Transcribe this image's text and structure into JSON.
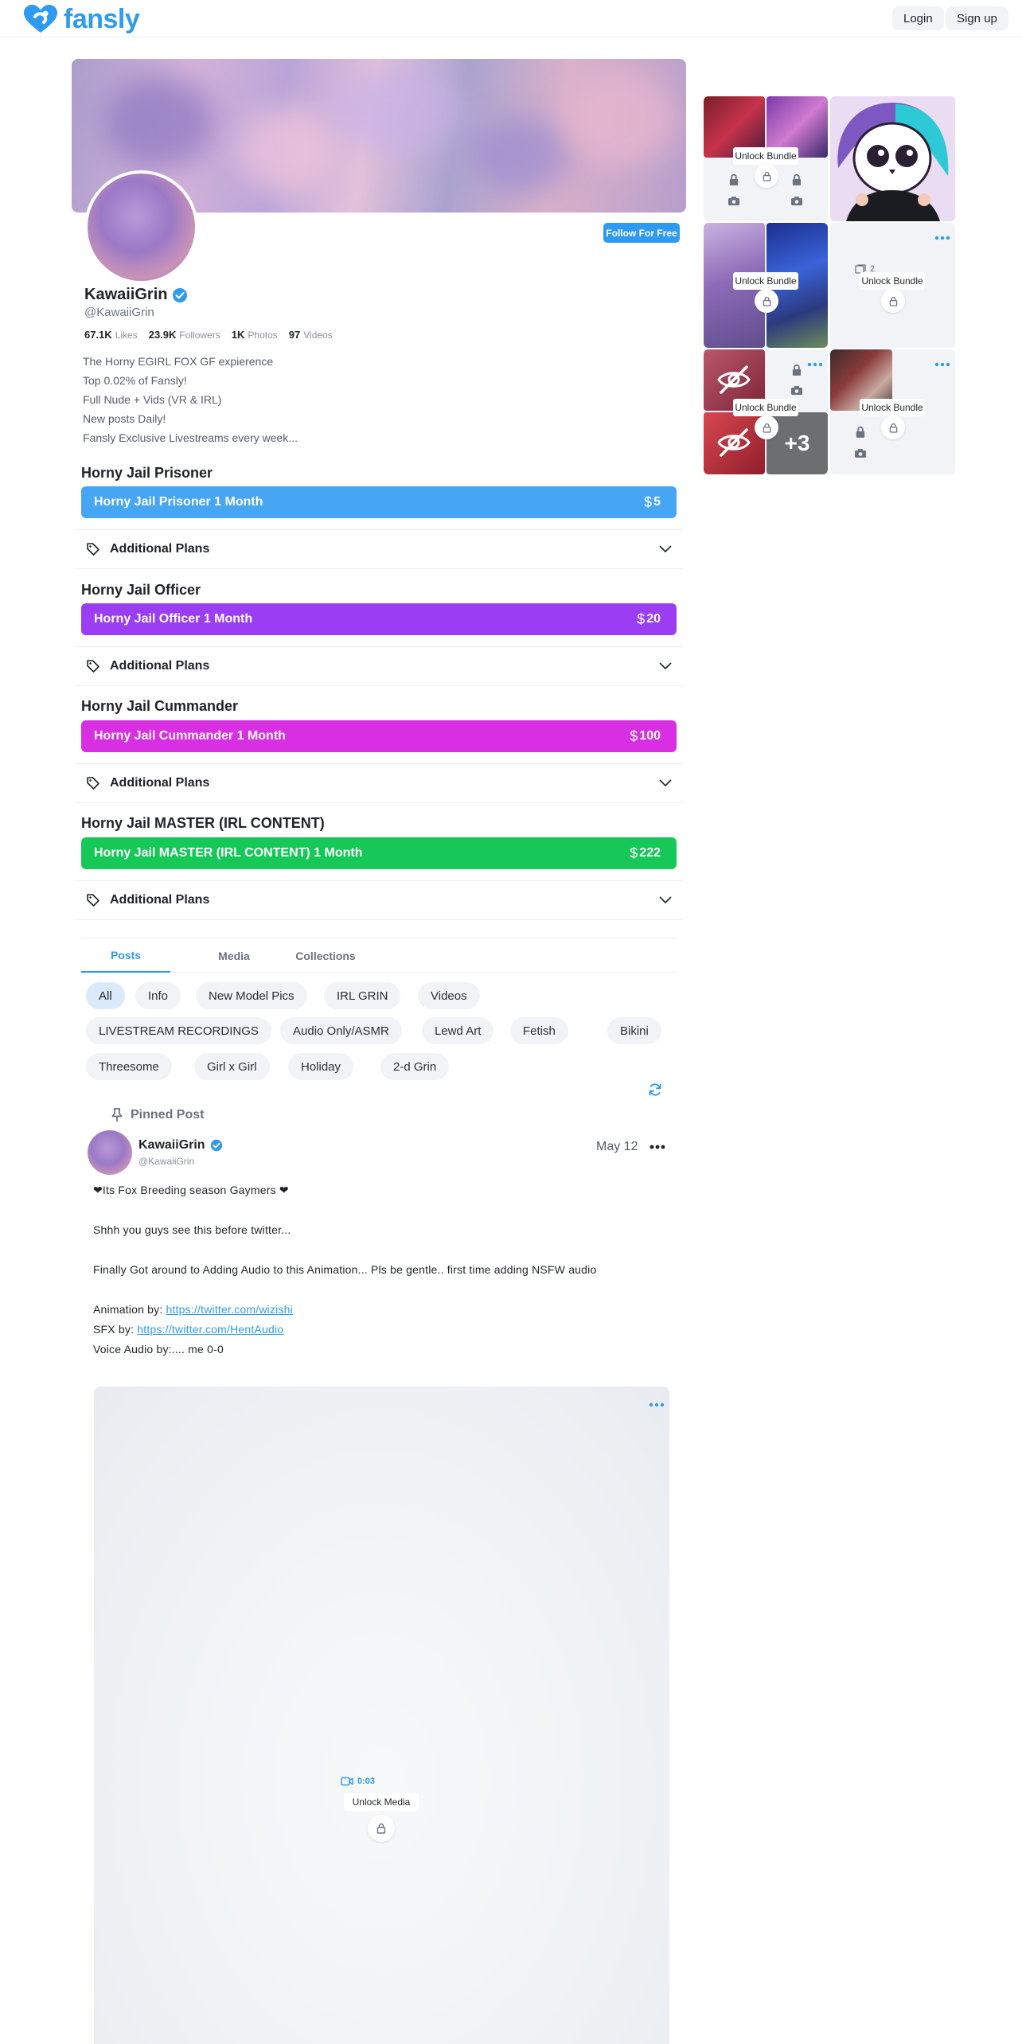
{
  "brand": {
    "name": "fansly",
    "color": "#2e9bf0"
  },
  "topbar": {
    "login_label": "Login",
    "signup_label": "Sign up"
  },
  "profile": {
    "follow_label": "Follow For Free",
    "name": "KawaiiGrin",
    "handle": "@KawaiiGrin",
    "stats": [
      {
        "value": "67.1K",
        "label": "Likes"
      },
      {
        "value": "23.9K",
        "label": "Followers"
      },
      {
        "value": "1K",
        "label": "Photos"
      },
      {
        "value": "97",
        "label": "Videos"
      }
    ],
    "bio": [
      "The Horny EGIRL FOX GF expierence",
      "Top 0.02% of Fansly!",
      "Full Nude + Vids (VR & IRL)",
      "New posts Daily!",
      "Fansly Exclusive Livestreams every week..."
    ]
  },
  "tiers": [
    {
      "title": "Horny Jail Prisoner",
      "bar_label": "Horny Jail Prisoner 1 Month",
      "price": "5",
      "color": "#46a6f3",
      "plans_label": "Additional Plans"
    },
    {
      "title": "Horny Jail Officer",
      "bar_label": "Horny Jail Officer 1 Month",
      "price": "20",
      "color": "#9b3df2",
      "plans_label": "Additional Plans"
    },
    {
      "title": "Horny Jail Cummander",
      "bar_label": "Horny Jail Cummander 1 Month",
      "price": "100",
      "color": "#d92fe3",
      "plans_label": "Additional Plans"
    },
    {
      "title": "Horny Jail MASTER (IRL CONTENT)",
      "bar_label": "Horny Jail MASTER (IRL CONTENT) 1 Month",
      "price": "222",
      "color": "#16c857",
      "plans_label": "Additional Plans"
    }
  ],
  "tabs": [
    "Posts",
    "Media",
    "Collections"
  ],
  "filters": [
    "All",
    "Info",
    "New Model Pics",
    "IRL GRIN",
    "Videos",
    "LIVESTREAM RECORDINGS",
    "Audio Only/ASMR",
    "Lewd Art",
    "Fetish",
    "Bikini",
    "Threesome",
    "Girl x Girl",
    "Holiday",
    "2-d Grin"
  ],
  "post": {
    "pinned_label": "Pinned Post",
    "author_name": "KawaiiGrin",
    "author_handle": "@KawaiiGrin",
    "date": "May 12",
    "lines": [
      "❤Its Fox Breeding season Gaymers ❤",
      "",
      "Shhh you guys see this before twitter...",
      "",
      "Finally Got around to Adding Audio to this Animation... Pls be gentle.. first time adding NSFW audio",
      "",
      "Animation by:",
      "SFX by:",
      "Voice Audio by:.... me 0-0"
    ],
    "links": {
      "animation": "https://twitter.com/wizishi",
      "sfx": "https://twitter.com/HentAudio"
    },
    "media_duration": "0:03",
    "unlock_media_label": "Unlock Media"
  },
  "sidebar": {
    "unlock_bundle_label": "Unlock Bundle",
    "bundle_count": "2",
    "more_count": "+3"
  }
}
